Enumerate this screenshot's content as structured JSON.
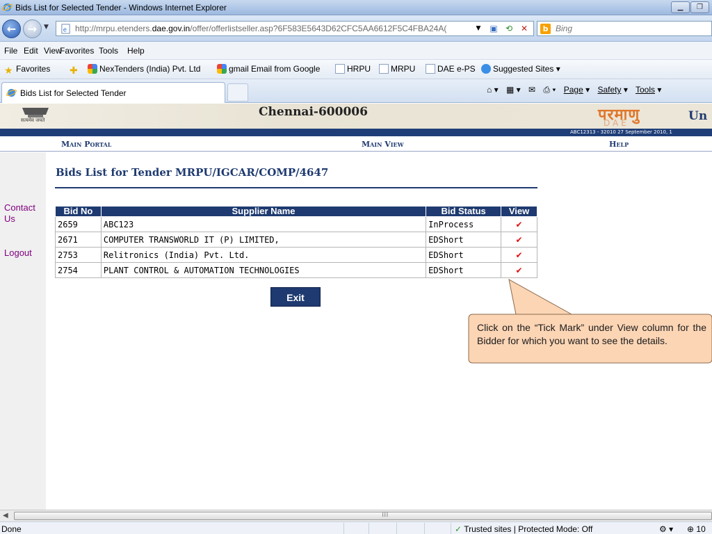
{
  "window": {
    "title": "Bids List for Selected Tender - Windows Internet Explorer"
  },
  "address": {
    "url_prefix": "http://mrpu.etenders.",
    "url_domain": "dae.gov.in",
    "url_suffix": "/offer/offerlistseller.asp?6F583E5643D62CFC5AA6612F5C4FBA24A(",
    "search_placeholder": "Bing"
  },
  "menu": {
    "items": [
      "File",
      "Edit",
      "View",
      "Favorites",
      "Tools",
      "Help"
    ]
  },
  "favorites": {
    "label": "Favorites",
    "items": [
      "NexTenders (India) Pvt. Ltd",
      "gmail Email from Google",
      "HRPU",
      "MRPU",
      "DAE e-PS",
      "Suggested Sites"
    ]
  },
  "tabs": {
    "active_label": "Bids List for Selected Tender",
    "commands": [
      "Page",
      "Safety",
      "Tools"
    ]
  },
  "banner": {
    "city": "Chennai-600006",
    "emblem_text": "सत्यमेव जयते",
    "logo_hindi": "परमाणु",
    "logo_dae": "DAE",
    "logo_right": "Un",
    "info": "ABC12313 - 32010     27 September 2010, 1"
  },
  "site_nav": {
    "main_portal": "Main Portal",
    "main_view": "Main View",
    "help": "Help"
  },
  "sidebar": {
    "contact": "Contact Us",
    "logout": "Logout"
  },
  "page": {
    "heading": "Bids List for Tender MRPU/IGCAR/COMP/4647"
  },
  "table": {
    "headers": [
      "Bid No",
      "Supplier Name",
      "Bid Status",
      "View"
    ],
    "rows": [
      {
        "bid_no": "2659",
        "supplier": "ABC123",
        "status": "InProcess",
        "view": "✔"
      },
      {
        "bid_no": "2671",
        "supplier": "COMPUTER TRANSWORLD IT (P) LIMITED,",
        "status": "EDShort",
        "view": "✔"
      },
      {
        "bid_no": "2753",
        "supplier": "Relitronics (India) Pvt. Ltd.",
        "status": "EDShort",
        "view": "✔"
      },
      {
        "bid_no": "2754",
        "supplier": "PLANT CONTROL & AUTOMATION TECHNOLOGIES",
        "status": "EDShort",
        "view": "✔"
      }
    ]
  },
  "exit_label": "Exit",
  "callout": {
    "text": "Click on the “Tick Mark” under View column for the Bidder  for which you want to see the details.",
    "fill": "#fcd5b5",
    "border": "#8a6a4c"
  },
  "status": {
    "left": "Done",
    "zone": "Trusted sites | Protected Mode: Off",
    "zoom": "10"
  },
  "colors": {
    "navy": "#1e3a70",
    "link": "#800080",
    "tick": "#e01010"
  }
}
